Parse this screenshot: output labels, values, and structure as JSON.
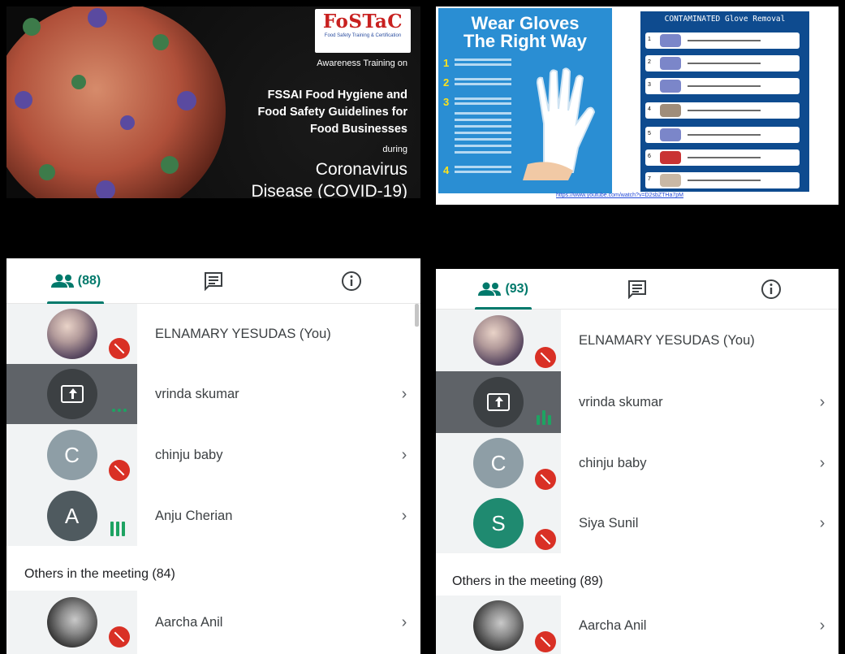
{
  "slide_left": {
    "logo": "FoSTaC",
    "logo_sub": "Food Safety Training & Certification",
    "awareness": "Awareness Training on",
    "main_lines": [
      "FSSAI Food Hygiene and",
      "Food Safety Guidelines for",
      "Food Businesses"
    ],
    "during": "during",
    "disease_lines": [
      "Coronavirus",
      "Disease (COVID-19)"
    ]
  },
  "slide_right": {
    "title_lines": [
      "Wear Gloves",
      "The Right Way"
    ],
    "steps": [
      "1",
      "2",
      "3",
      "4"
    ],
    "removal_title": "CONTAMINATED Glove Removal",
    "removal_steps": [
      "1",
      "2",
      "3",
      "4",
      "5",
      "6",
      "7"
    ],
    "link": "https://www.youtube.com/watch?v=D2sbZTHa7pM"
  },
  "panel_left": {
    "people_count": "(88)",
    "participants": [
      {
        "name": "ELNAMARY YESUDAS (You)",
        "avatar": "",
        "state": "muted"
      },
      {
        "name": "vrinda skumar",
        "avatar": "",
        "state": "presenting"
      },
      {
        "name": "chinju baby",
        "avatar": "C",
        "state": "muted"
      },
      {
        "name": "Anju Cherian",
        "avatar": "A",
        "state": "speaking"
      }
    ],
    "others_label": "Others in the meeting (84)",
    "others": [
      {
        "name": "Aarcha Anil",
        "state": "muted"
      }
    ]
  },
  "panel_right": {
    "people_count": "(93)",
    "participants": [
      {
        "name": "ELNAMARY YESUDAS (You)",
        "avatar": "",
        "state": "muted"
      },
      {
        "name": "vrinda skumar",
        "avatar": "",
        "state": "presenting"
      },
      {
        "name": "chinju baby",
        "avatar": "C",
        "state": "muted"
      },
      {
        "name": "Siya Sunil",
        "avatar": "S",
        "state": "muted"
      }
    ],
    "others_label": "Others in the meeting (89)",
    "others": [
      {
        "name": "Aarcha Anil",
        "state": "muted"
      }
    ]
  },
  "icons": {
    "people": "people-icon",
    "chat": "chat-icon",
    "info": "info-icon",
    "chevron": "›",
    "mic_off": "mic-off-icon"
  },
  "colors": {
    "accent": "#00796b",
    "muted_red": "#d93025",
    "speaking_green": "#1ea362",
    "avatar_c": "#8e9ea6",
    "avatar_a": "#4f5a5f",
    "avatar_s": "#1f8a70"
  }
}
